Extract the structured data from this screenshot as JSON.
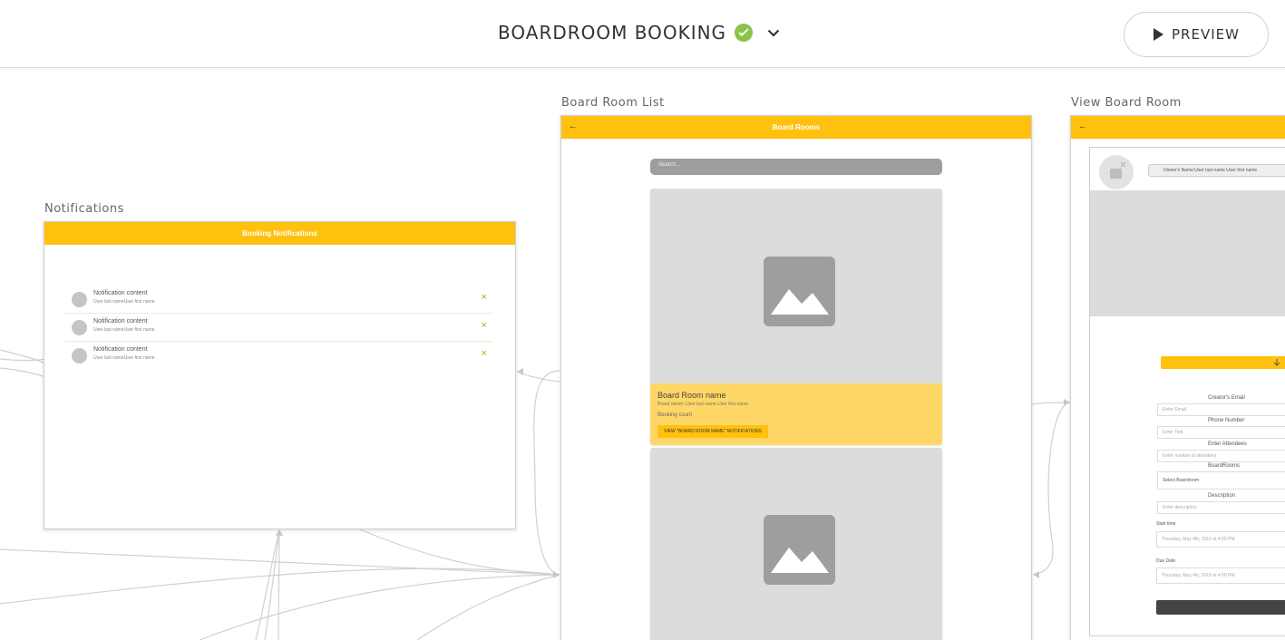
{
  "header": {
    "title": "BOARDROOM BOOKING",
    "preview_label": "PREVIEW"
  },
  "colors": {
    "accent": "#ffc10e",
    "card_info": "#ffd766",
    "status_ok": "#8bc34a"
  },
  "notifications_screen": {
    "label": "Notifications",
    "appbar_title": "Booking Notifications",
    "items": [
      {
        "title": "Notification content",
        "subtitle": "User last nameUser first name",
        "close": "×"
      },
      {
        "title": "Notification content",
        "subtitle": "User last nameUser first name",
        "close": "×"
      },
      {
        "title": "Notification content",
        "subtitle": "User last nameUser first name",
        "close": "×"
      }
    ]
  },
  "board_room_list_screen": {
    "label": "Board Room List",
    "appbar_title": "Board Rooms",
    "back": "←",
    "search_placeholder": "Search...",
    "card": {
      "name": "Board Room name",
      "owner": "Board owner: User last name User first name",
      "booking_count": "Booking count",
      "button_label": "VIEW \"BOARD ROOM NAME\" NOTIFICATIONS"
    }
  },
  "view_board_room_screen": {
    "label": "View Board Room",
    "back": "←",
    "owner_name": "Owner's Name:User last name User first name",
    "fields": [
      {
        "label": "Creator's Email",
        "placeholder": "Enter Email"
      },
      {
        "label": "Phone Number",
        "placeholder": "Enter Text"
      },
      {
        "label": "Enter Attendees",
        "placeholder": "Enter number of attendees"
      },
      {
        "label": "BoardRooms",
        "placeholder": "Select Boardroom"
      },
      {
        "label": "Description",
        "placeholder": "Enter description"
      }
    ],
    "start_time_label": "Start time",
    "start_time_value": "Thursday, May 4th, 2019 at 4:00 PM",
    "due_date_label": "Due Date",
    "due_date_value": "Thursday, May 4th, 2019 at 4:00 PM"
  }
}
